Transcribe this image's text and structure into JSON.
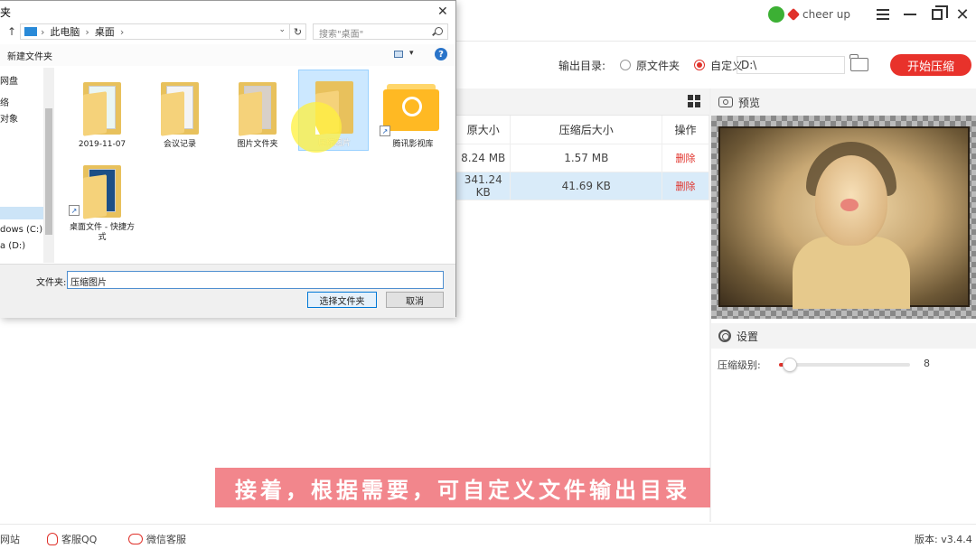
{
  "app": {
    "user_name": "cheer up",
    "output": {
      "label": "输出目录:",
      "option_original": "原文件夹",
      "option_custom": "自定义",
      "dir_value": "D:\\"
    },
    "start_button": "开始压缩",
    "table": {
      "headers": [
        "原大小",
        "压缩后大小",
        "操作"
      ],
      "rows": [
        {
          "orig": "8.24 MB",
          "compressed": "1.57 MB",
          "action": "删除"
        },
        {
          "orig": "341.24 KB",
          "compressed": "41.69 KB",
          "action": "删除"
        }
      ]
    },
    "preview": {
      "title": "预览"
    },
    "settings": {
      "title": "设置",
      "level_label": "压缩级别:",
      "level_value": "8",
      "level_fraction": 0.08
    },
    "subtitle": "接着，根据需要，可自定义文件输出目录",
    "statusbar": {
      "website": "网站",
      "qq": "客服QQ",
      "wechat": "微信客服",
      "version": "版本: v3.4.4"
    },
    "colors": {
      "accent": "#e8322b",
      "subtitle_bg": "#f2868c",
      "selected_row": "#d9ebf9"
    }
  },
  "dialog": {
    "title": "夹",
    "address": [
      "此电脑",
      "桌面"
    ],
    "search_placeholder": "搜索\"桌面\"",
    "new_folder": "新建文件夹",
    "nav_items": [
      "网盘",
      "络",
      "对象",
      "",
      "",
      "",
      "",
      "",
      "dows (C:)",
      "a (D:)"
    ],
    "files": [
      {
        "name": "2019-11-07",
        "shortcut": false
      },
      {
        "name": "会议记录",
        "shortcut": false
      },
      {
        "name": "图片文件夹",
        "shortcut": false
      },
      {
        "name": "压缩图片",
        "shortcut": false,
        "selected": true
      },
      {
        "name": "腾讯影视库",
        "shortcut": true
      },
      {
        "name": "桌面文件 - 快捷方式",
        "shortcut": true
      }
    ],
    "folder_label": "文件夹:",
    "folder_value": "压缩图片",
    "select_button": "选择文件夹",
    "cancel_button": "取消"
  }
}
